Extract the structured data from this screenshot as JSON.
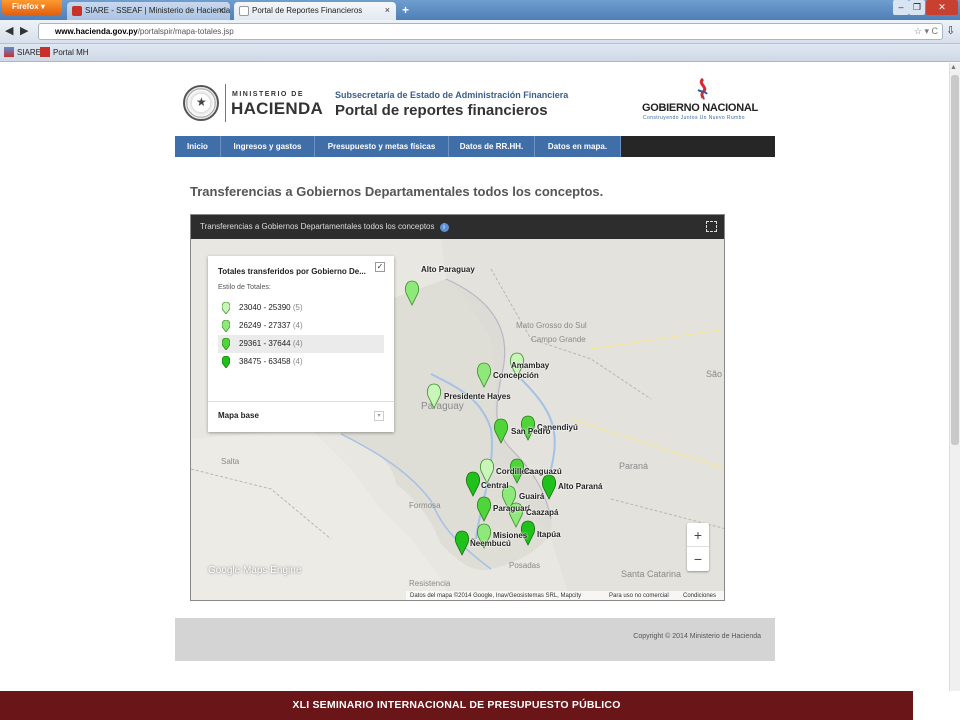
{
  "browser": {
    "app_button": "Firefox",
    "tabs": [
      {
        "label": "SIARE - SSEAF | Ministerio de Hacienda",
        "active": false
      },
      {
        "label": "Portal de Reportes Financieros",
        "active": true
      }
    ],
    "new_tab": "+",
    "url_domain": "www.hacienda.gov.py",
    "url_path": "/portalspir/mapa-totales.jsp",
    "bookmarks": [
      "SIARE",
      "Portal MH"
    ]
  },
  "header": {
    "ministry_small": "MINISTERIO DE",
    "ministry_big": "HACIENDA",
    "subsecretaria": "Subsecretaría de Estado de Administración Financiera",
    "portal_title": "Portal de reportes financieros",
    "gov_logo": "GOBIERNO NACIONAL",
    "gov_tagline": "Construyendo Juntos Un Nuevo Rumbo"
  },
  "menu": [
    "Inicio",
    "Ingresos y gastos",
    "Presupuesto y metas físicas",
    "Datos de RR.HH.",
    "Datos en mapa."
  ],
  "page_title": "Transferencias a Gobiernos Departamentales todos los conceptos.",
  "map": {
    "header_title": "Transferencias a Gobiernos Departamentales todos los conceptos",
    "legend": {
      "title": "Totales transferidos por Gobierno De...",
      "style_label": "Estilo de Totales:",
      "ranges": [
        {
          "range": "23040 - 25390",
          "count": "(5)",
          "color": "#c8f5b8"
        },
        {
          "range": "26249 - 27337",
          "count": "(4)",
          "color": "#8fe87a"
        },
        {
          "range": "29361 - 37644",
          "count": "(4)",
          "color": "#4fd43a"
        },
        {
          "range": "38475 - 63458",
          "count": "(4)",
          "color": "#1ec21a"
        }
      ],
      "base_map": "Mapa base"
    },
    "departments": [
      "Alto Paraguay",
      "Amambay",
      "Concepción",
      "Presidente Hayes",
      "Canendiyú",
      "San Pedro",
      "Cordillera",
      "Caaguazú",
      "Central",
      "Alto Paraná",
      "Guairá",
      "Paraguarí",
      "Caazapá",
      "Misiones",
      "Itapúa",
      "Ñeembucú"
    ],
    "background_labels": [
      "Campo Grande",
      "Mato Grosso do Sul",
      "Paraguay",
      "Paraná",
      "Santa Catarina",
      "Salta",
      "Formosa",
      "Resistencia",
      "Posadas",
      "São"
    ],
    "zoom_in": "+",
    "zoom_out": "−",
    "brand": "Google Maps Engine",
    "attribution": "Datos del mapa ©2014 Google, Inav/Geosistemas SRL, Mapcity",
    "terms": "Para uso no comercial",
    "conditions": "Condiciones"
  },
  "copyright": "Copyright © 2014 Ministerio de Hacienda",
  "banner": "XLI SEMINARIO INTERNACIONAL DE PRESUPUESTO PÚBLICO"
}
